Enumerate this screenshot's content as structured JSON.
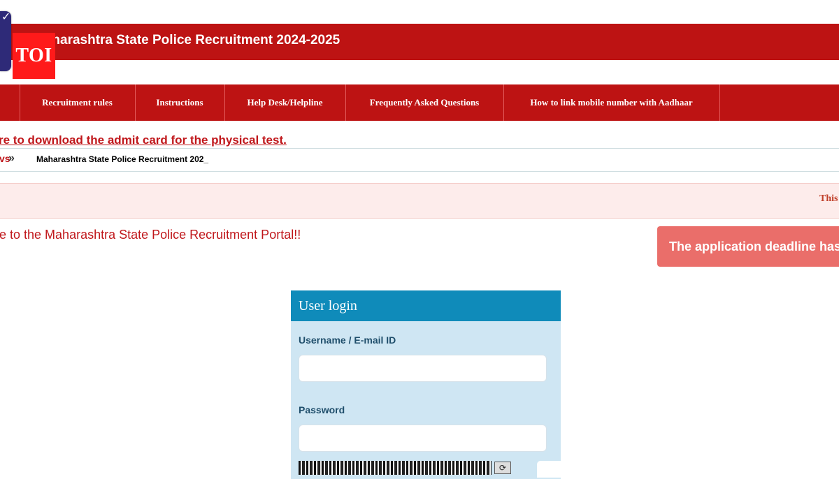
{
  "header": {
    "title": "Maharashtra State Police Recruitment 2024-2025",
    "emblem_icon": "emblem-icon",
    "watermark": "TOI",
    "bar_color": "#bd1313"
  },
  "nav": {
    "items": [
      {
        "label": ""
      },
      {
        "label": "Recruitment rules"
      },
      {
        "label": "Instructions"
      },
      {
        "label": "Help Desk/Helpline"
      },
      {
        "label": "Frequently Asked Questions"
      },
      {
        "label": "How to link mobile number with Aadhaar"
      }
    ]
  },
  "notice": {
    "admit_card_link": "re to download the admit card for the physical test."
  },
  "news": {
    "label": "vs",
    "arrow": "»",
    "ticker_text": "Maharashtra State Police Recruitment 202_"
  },
  "alert": {
    "text": "This"
  },
  "welcome": {
    "text": "e to the Maharashtra State Police Recruitment Portal!!"
  },
  "deadline": {
    "text": "The application deadline has"
  },
  "login": {
    "title": "User login",
    "username_label": "Username / E-mail ID",
    "username_value": "",
    "password_label": "Password",
    "password_value": "",
    "refresh_icon": "refresh-icon",
    "header_color": "#0f8bba",
    "panel_color": "#cfe6f3"
  }
}
